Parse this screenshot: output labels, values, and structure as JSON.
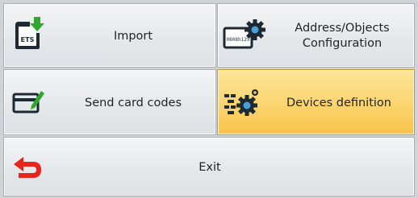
{
  "menu": {
    "import": {
      "label": "Import",
      "icon": "ets-import-icon"
    },
    "address_objects": {
      "label_line1": "Address/Objects",
      "label_line2": "Configuration",
      "icon": "address-gear-icon",
      "icon_text": "0808h125"
    },
    "send_card_codes": {
      "label": "Send card codes",
      "icon": "card-pen-icon"
    },
    "devices_definition": {
      "label": "Devices definition",
      "icon": "devices-gear-icon",
      "selected": true
    },
    "exit": {
      "label": "Exit",
      "icon": "exit-arrow-icon"
    }
  },
  "colors": {
    "selected_tile": "#fbd46d",
    "exit_arrow": "#e8241d",
    "import_arrow": "#2fa82c"
  }
}
